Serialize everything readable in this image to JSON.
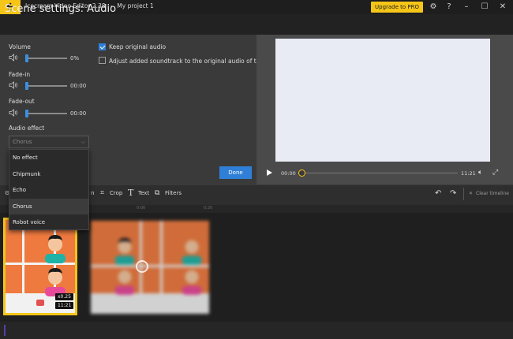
{
  "titlebar": {
    "app_name": "Icecream Video Editor 2.38",
    "separator": "-",
    "project": "My project 1",
    "upgrade_label": "Upgrade to PRO",
    "icons": [
      "gear-icon",
      "help-icon",
      "minimize-icon",
      "maximize-icon",
      "close-icon"
    ],
    "help_glyph": "?",
    "minimize_glyph": "–",
    "maximize_glyph": "☐",
    "close_glyph": "✕",
    "gear_glyph": "⚙"
  },
  "header": {
    "title": "Scene settings: Audio"
  },
  "settings": {
    "volume": {
      "label": "Volume",
      "value": "0%",
      "level": 0
    },
    "fade_in": {
      "label": "Fade-in",
      "value": "00:00",
      "level": 0
    },
    "fade_out": {
      "label": "Fade-out",
      "value": "00:00",
      "level": 0
    },
    "audio_effect": {
      "label": "Audio effect",
      "selected": "Chorus",
      "options": [
        "No effect",
        "Chipmunk",
        "Echo",
        "Chorus",
        "Robot voice"
      ]
    },
    "keep_original": {
      "label": "Keep original audio",
      "checked": true
    },
    "adjust_soundtrack": {
      "label": "Adjust added soundtrack to the original audio of the scene",
      "checked": false
    },
    "done_label": "Done"
  },
  "player": {
    "current_time": "00:00",
    "total_time": "11:21",
    "progress": 0
  },
  "toolbar": {
    "partial_label": "n",
    "crop_label": "Crop",
    "text_label": "Text",
    "filters_label": "Filters",
    "clear_label": "Clear timeline"
  },
  "ruler": {
    "labels": [
      "0:00",
      "0:20"
    ]
  },
  "timeline": {
    "clips": [
      {
        "speed": "x0.25",
        "duration": "11:21",
        "selected": true
      }
    ]
  },
  "colors": {
    "accent_yellow": "#f5c518",
    "accent_blue": "#2f7fd8",
    "clip_orange": "#ef7a3f"
  }
}
